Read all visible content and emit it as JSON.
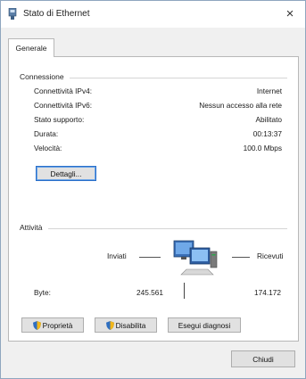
{
  "window": {
    "title": "Stato di Ethernet",
    "close_glyph": "×"
  },
  "tabs": [
    {
      "label": "Generale"
    }
  ],
  "connection": {
    "group_title": "Connessione",
    "rows": [
      {
        "label": "Connettività IPv4:",
        "value": "Internet"
      },
      {
        "label": "Connettività IPv6:",
        "value": "Nessun accesso alla rete"
      },
      {
        "label": "Stato supporto:",
        "value": "Abilitato"
      },
      {
        "label": "Durata:",
        "value": "00:13:37"
      },
      {
        "label": "Velocità:",
        "value": "100.0 Mbps"
      }
    ],
    "details_button": "Dettagli..."
  },
  "activity": {
    "group_title": "Attività",
    "sent_label": "Inviati",
    "received_label": "Ricevuti",
    "bytes_label": "Byte:",
    "bytes_sent": "245.561",
    "bytes_received": "174.172",
    "icon": "network-computers-icon"
  },
  "buttons": {
    "properties": "Proprietà",
    "disable": "Disabilita",
    "diagnose": "Esegui diagnosi",
    "close": "Chiudi"
  },
  "colors": {
    "accent": "#2a6fc9",
    "button_face": "#e1e1e1",
    "panel_bg": "#f0f0f0"
  }
}
